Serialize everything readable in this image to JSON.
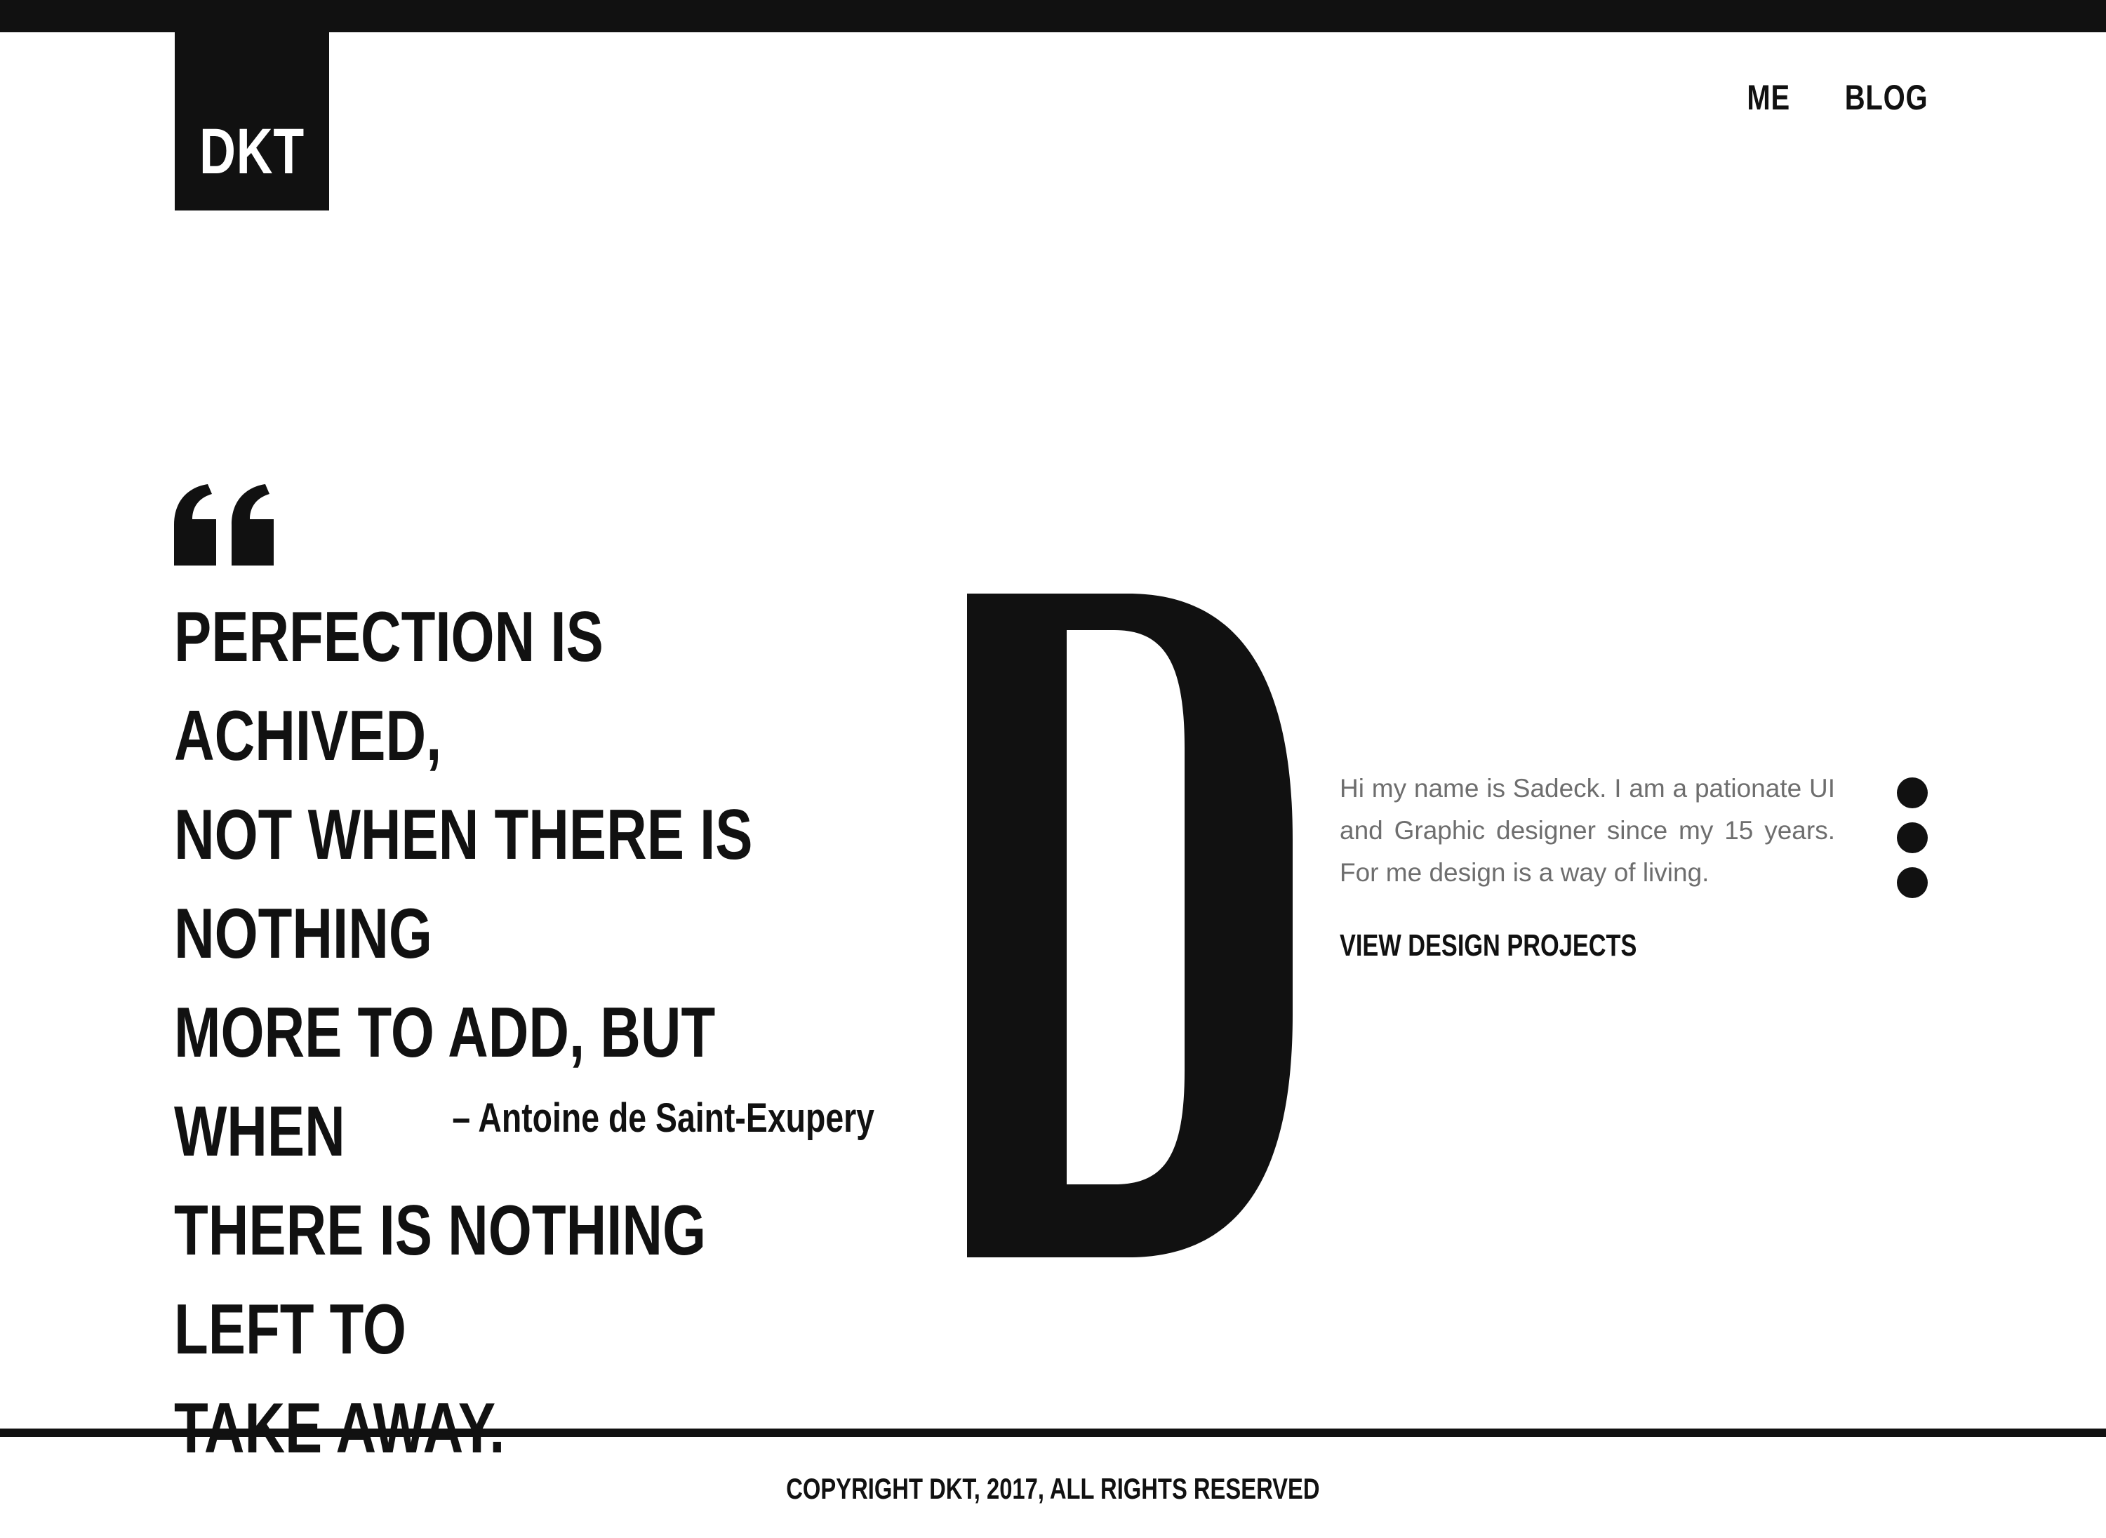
{
  "brand": {
    "logo_text": "DKT"
  },
  "nav": {
    "items": [
      {
        "label": "ME"
      },
      {
        "label": "BLOG"
      }
    ]
  },
  "quote": {
    "icon": "quote-icon",
    "text": "PERFECTION IS ACHIVED,\nNOT WHEN THERE IS NOTHING\nMORE TO ADD, BUT WHEN\nTHERE IS NOTHING LEFT TO\nTAKE AWAY.",
    "author": "– Antoine de Saint-Exupery"
  },
  "hero": {
    "letter": "D"
  },
  "about": {
    "bio": "Hi my name is Sadeck. I am a pationate UI and Graphic designer since my 15 years. For me design is a way of living.",
    "cta_label": "VIEW DESIGN PROJECTS"
  },
  "pager": {
    "dots": 3
  },
  "footer": {
    "copyright": "COPYRIGHT DKT, 2017, ALL RIGHTS RESERVED"
  },
  "colors": {
    "primary": "#111111",
    "background": "#ffffff",
    "muted_text": "#6e6e6e"
  }
}
